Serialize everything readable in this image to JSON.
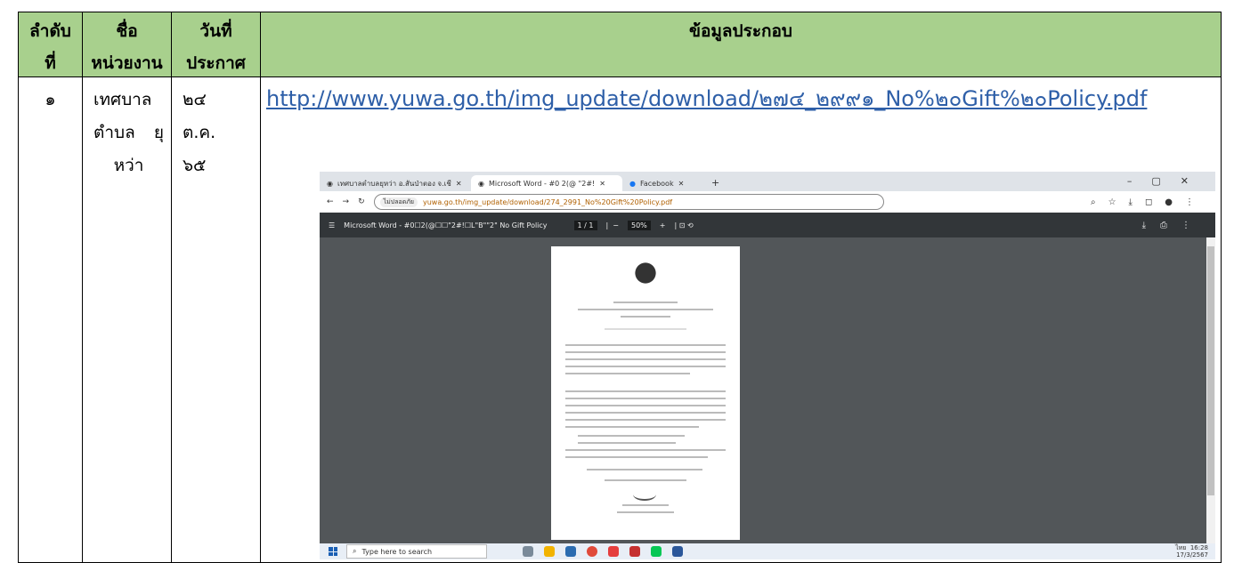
{
  "table": {
    "headers": [
      {
        "line1": "ลำดับ",
        "line2": "ที่"
      },
      {
        "line1": "ชื่อ",
        "line2": "หน่วยงาน"
      },
      {
        "line1": "วันที่",
        "line2": "ประกาศ"
      },
      {
        "line1": "ข้อมูลประกอบ",
        "line2": ""
      }
    ],
    "row": {
      "number": "๑",
      "org_line1": "เทศบาล",
      "org_line2a": "ตำบล",
      "org_line2b": "ยุ",
      "org_line3": "หว่า",
      "date_line1": "๒๔",
      "date_line2": "ต.ค.",
      "date_line3": "๖๕",
      "link": "http://www.yuwa.go.th/img_update/download/๒๗๔_๒๙๙๑_No%๒๐Gift%๒๐Policy.pdf"
    }
  },
  "screenshot": {
    "tab1": "เทศบาลตำบลยุหว่า อ.สันป่าตอง จ.เชี",
    "tab2": "Microsoft Word - #0 2(@ \"2#! ",
    "tab3": "Facebook",
    "warning": "ไม่ปลอดภัย",
    "url": "yuwa.go.th/img_update/download/274_2991_No%20Gift%20Policy.pdf",
    "pdf_title": "Microsoft Word - #0☐2(@☐☐\"2#!☐L\"B\"\"2\" No Gift Policy",
    "page": "1 / 1",
    "zoom": "50%",
    "search_placeholder": "Type here to search",
    "time": "16:28",
    "date": "17/3/2567",
    "lang": "ไทย"
  }
}
